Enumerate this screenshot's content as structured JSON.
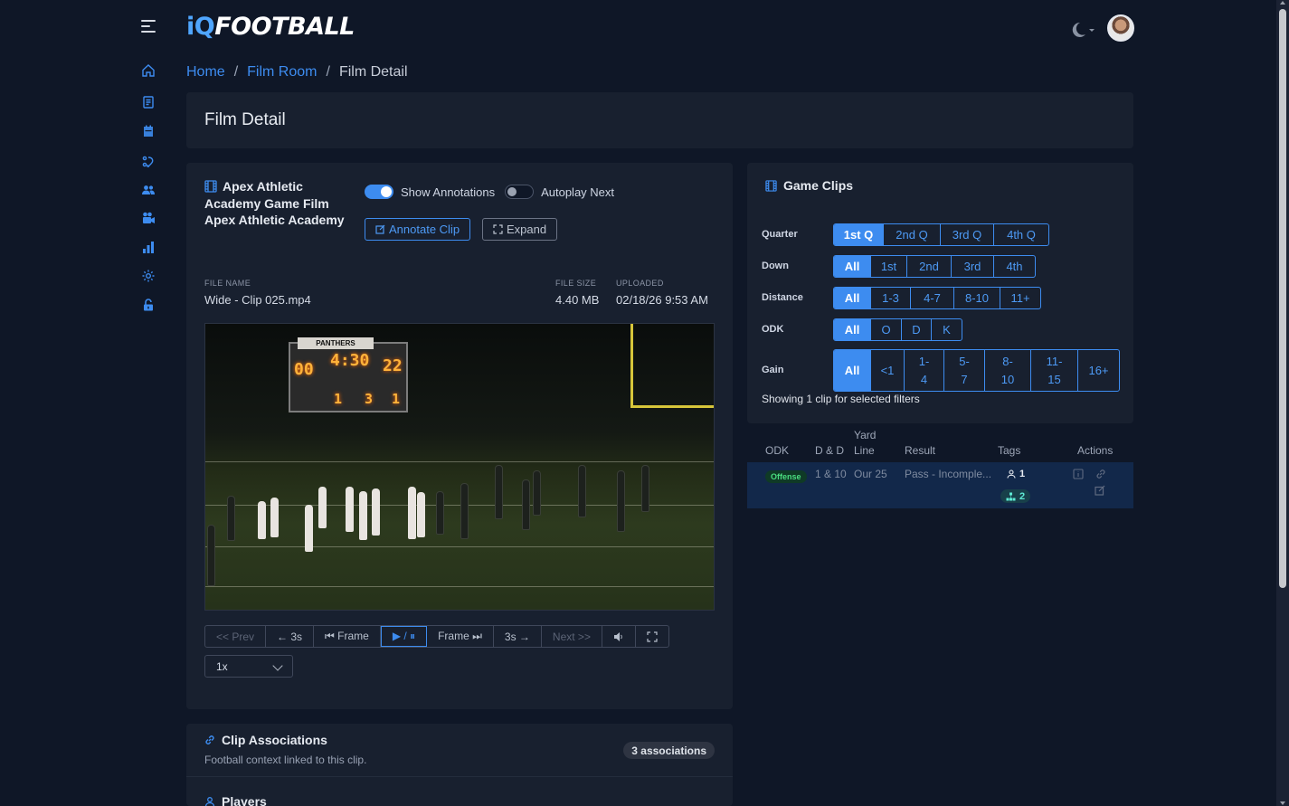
{
  "app": {
    "logo_iq": "iQ",
    "logo_rest": "FOOTBALL"
  },
  "breadcrumb": {
    "home": "Home",
    "film_room": "Film Room",
    "current": "Film Detail"
  },
  "page": {
    "title": "Film Detail"
  },
  "film": {
    "title": "Apex Athletic Academy Game Film Apex Athletic Academy",
    "show_annotations": "Show Annotations",
    "autoplay_next": "Autoplay Next",
    "annotate_label": "Annotate Clip",
    "expand_label": "Expand",
    "file_name_label": "FILE NAME",
    "file_name": "Wide - Clip 025.mp4",
    "file_size_label": "FILE SIZE",
    "file_size": "4.40 MB",
    "uploaded_label": "UPLOADED",
    "uploaded": "02/18/26 9:53 AM",
    "scoreboard": {
      "team": "PANTHERS",
      "home": "00",
      "clock": "4:30",
      "guests": "22",
      "down": "1",
      "togo": "3",
      "qtr": "1"
    },
    "controls": {
      "prev": "<< Prev",
      "back3": "← 3s",
      "frame_back": "⏮ Frame",
      "playpause": "▶ / ⏸",
      "frame_fwd": "Frame ⏭",
      "fwd3": "3s →",
      "next": "Next >>"
    },
    "speed": "1x"
  },
  "associations": {
    "title": "Clip Associations",
    "subtitle": "Football context linked to this clip.",
    "badge": "3 associations",
    "players_title": "Players"
  },
  "game_clips": {
    "title": "Game Clips",
    "filters": {
      "quarter": {
        "label": "Quarter",
        "options": [
          "1st Q",
          "2nd Q",
          "3rd Q",
          "4th Q"
        ],
        "active": "1st Q"
      },
      "down": {
        "label": "Down",
        "options": [
          "All",
          "1st",
          "2nd",
          "3rd",
          "4th"
        ],
        "active": "All"
      },
      "distance": {
        "label": "Distance",
        "options": [
          "All",
          "1-3",
          "4-7",
          "8-10",
          "11+"
        ],
        "active": "All"
      },
      "odk": {
        "label": "ODK",
        "options": [
          "All",
          "O",
          "D",
          "K"
        ],
        "active": "All"
      },
      "gain": {
        "label": "Gain",
        "options": [
          "All",
          "<1",
          "1- 4",
          "5- 7",
          "8- 10",
          "11- 15",
          "16+"
        ],
        "active": "All"
      }
    },
    "showing": "Showing 1 clip for selected filters",
    "columns": {
      "odk": "ODK",
      "dd": "D & D",
      "yard": "Yard Line",
      "result": "Result",
      "tags": "Tags",
      "actions": "Actions"
    },
    "rows": [
      {
        "odk": "Offense",
        "dd": "1 & 10",
        "yard": "Our 25",
        "result": "Pass - Incomple...",
        "tag_players": "1",
        "tag_formations": "2"
      }
    ]
  }
}
